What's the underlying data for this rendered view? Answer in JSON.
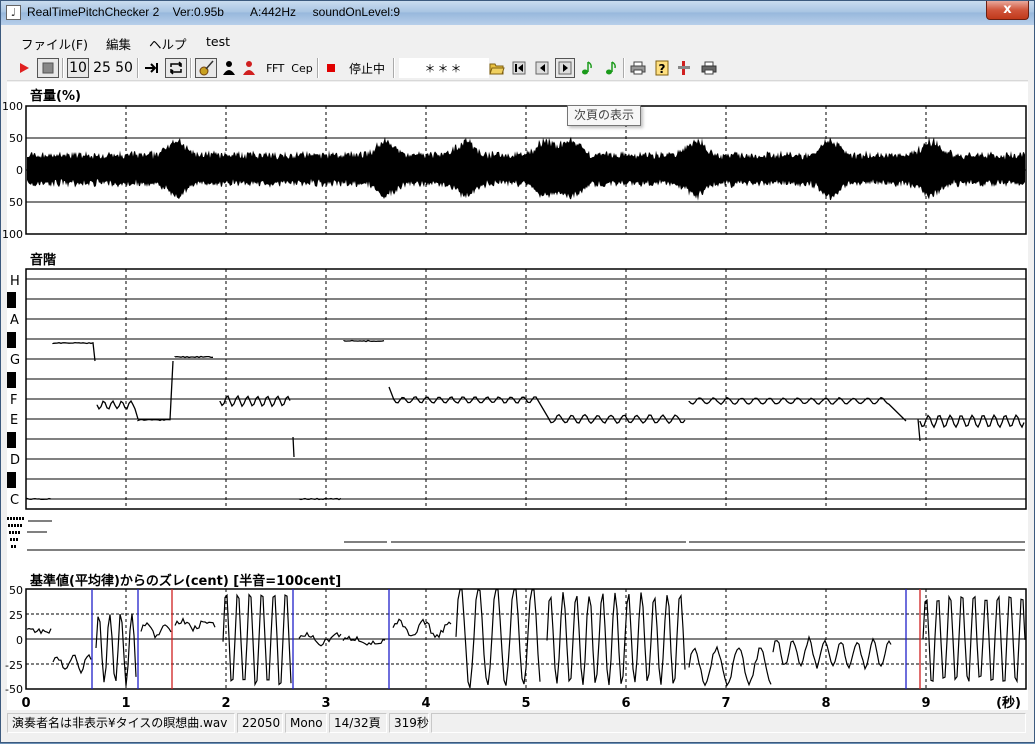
{
  "window": {
    "title": "RealTimePitchChecker 2    Ver:0.95b        A:442Hz     soundOnLevel:9",
    "close_label": "x"
  },
  "menu": [
    "ファイル(F)",
    "編集",
    "ヘルプ",
    "test"
  ],
  "toolbar": {
    "speed_labels": [
      "10",
      "25",
      "50"
    ],
    "fft_label": "FFT",
    "cep_label": "Cep",
    "status": "停止中",
    "display": "＊＊＊"
  },
  "tooltip": "次頁の表示",
  "panels": {
    "volume": {
      "title": "音量(%)",
      "ticks": [
        "100",
        "50",
        "0",
        "50",
        "100"
      ]
    },
    "scale": {
      "title": "音階",
      "notes": [
        "H",
        "A",
        "G",
        "F",
        "E",
        "D",
        "C"
      ]
    },
    "deviation": {
      "title": "基準値(平均律)からのズレ(cent) [半音=100cent]",
      "ticks": [
        "50",
        "25",
        "0",
        "-25",
        "-50"
      ]
    },
    "time_axis": {
      "ticks": [
        "0",
        "1",
        "2",
        "3",
        "4",
        "5",
        "6",
        "7",
        "8",
        "9"
      ],
      "unit": "(秒)"
    }
  },
  "statusbar": [
    "演奏者名は非表示¥タイスの瞑想曲.wav",
    "22050",
    "Mono",
    "14/32頁",
    "319秒"
  ],
  "colors": {
    "play": "#e02020",
    "stop": "#e00000",
    "note_icon": "#1a9a1a",
    "marker_red": "#d02020",
    "marker_blue": "#2020c8"
  }
}
